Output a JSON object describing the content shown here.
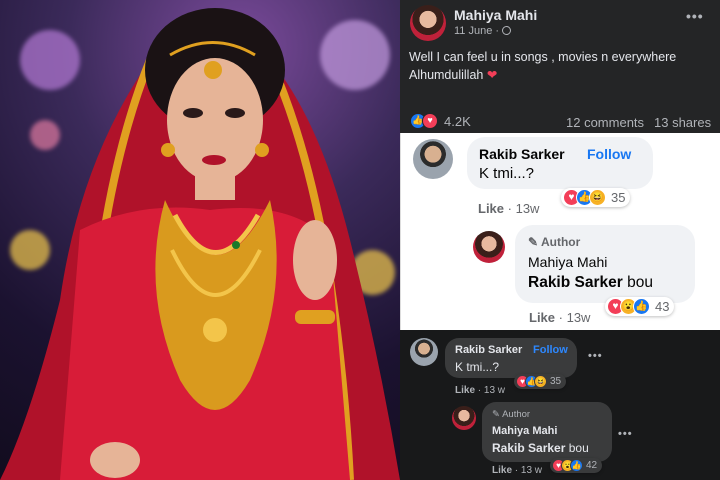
{
  "post": {
    "author": "Mahiya Mahi",
    "date": "11 June",
    "privacy_icon": "globe-icon",
    "text_line1": "Well I can feel u in songs , movies n everywhere",
    "text_line2": "Alhumdulillah",
    "heart_emoji": "❤",
    "reaction_count": "4.2K",
    "comments": "12 comments",
    "shares": "13 shares",
    "more_icon": "more-dots-icon"
  },
  "comment_light": {
    "author": "Rakib Sarker",
    "follow": "Follow",
    "text": "K tmi...?",
    "reactions_count": "35",
    "like_label": "Like",
    "time": "13w"
  },
  "reply_light": {
    "badge": "Author",
    "author": "Mahiya Mahi",
    "mention": "Rakib Sarker",
    "text": "bou",
    "reactions_count": "43",
    "like_label": "Like",
    "time": "13w"
  },
  "comment_dark": {
    "author": "Rakib Sarker",
    "follow": "Follow",
    "text": "K tmi...?",
    "reactions_count": "35",
    "like_label": "Like",
    "time": "13 w"
  },
  "reply_dark": {
    "badge": "Author",
    "author": "Mahiya Mahi",
    "mention": "Rakib Sarker",
    "text": "bou",
    "reactions_count": "42",
    "like_label": "Like",
    "time": "13 w"
  },
  "colors": {
    "facebook_blue": "#1877f2",
    "love_red": "#f33e58",
    "dark_bg": "#242526",
    "bubble_dark": "#3a3b3c",
    "bubble_light": "#f0f2f5"
  }
}
